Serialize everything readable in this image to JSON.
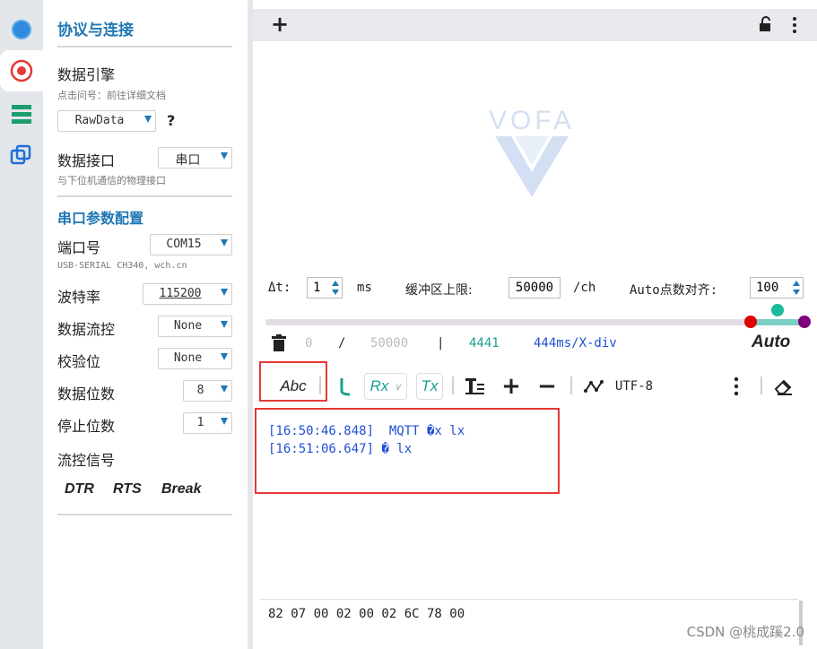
{
  "sidebar": {
    "icons": [
      "circle-dot-icon",
      "record-icon",
      "list-icon",
      "copy-icon"
    ]
  },
  "panel": {
    "title": "协议与连接",
    "engine": {
      "label": "数据引擎",
      "hint": "点击问号：前往详细文档",
      "value": "RawData",
      "help": "?"
    },
    "interface": {
      "label": "数据接口",
      "value": "串口",
      "hint": "与下位机通信的物理接口"
    },
    "serial_title": "串口参数配置",
    "port": {
      "label": "端口号",
      "value": "COM15",
      "hint": "USB-SERIAL CH340, wch.cn"
    },
    "baud": {
      "label": "波特率",
      "value": "115200"
    },
    "flow": {
      "label": "数据流控",
      "value": "None"
    },
    "parity": {
      "label": "校验位",
      "value": "None"
    },
    "databits": {
      "label": "数据位数",
      "value": "8"
    },
    "stopbits": {
      "label": "停止位数",
      "value": "1"
    },
    "flowsig": {
      "label": "流控信号",
      "dtr": "DTR",
      "rts": "RTS",
      "brk": "Break"
    }
  },
  "main": {
    "add": "+",
    "logo": "VOFA",
    "dt_label": "Δt:",
    "dt_value": "1",
    "dt_unit": "ms",
    "buffer_label": "缓冲区上限:",
    "buffer_value": "50000",
    "buffer_unit": "/ch",
    "auto_label": "Auto点数对齐:",
    "auto_value": "100",
    "slider_colors": [
      "#e00000",
      "#1abc9c",
      "#800080"
    ],
    "stat_a": "0",
    "stat_slash": "/",
    "stat_b": "50000",
    "stat_bar": "|",
    "stat_c": "4441",
    "stat_d": "444ms/X-div",
    "auto_btn": "Auto",
    "abc": "Abc",
    "rx": "Rx",
    "tx": "Tx",
    "encoding": "UTF-8",
    "log": [
      "[16:50:46.848]  MQTT �x lx",
      "[16:51:06.647] � lx"
    ],
    "hex": "82 07 00 02 00 02 6C 78 00",
    "watermark": "CSDN @桃成蹊2.0"
  }
}
